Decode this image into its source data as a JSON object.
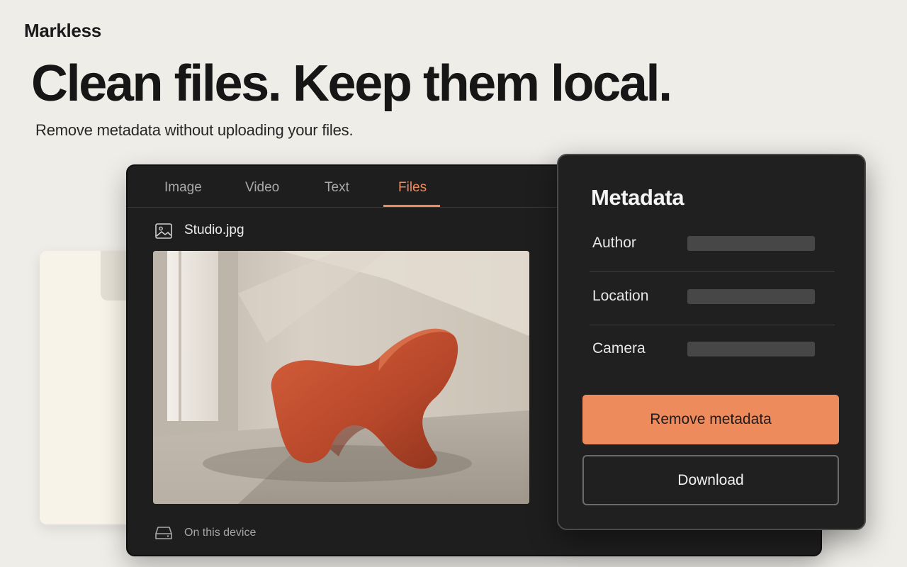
{
  "brand": "Markless",
  "hero": {
    "headline": "Clean files. Keep them local.",
    "subhead": "Remove metadata without uploading your files."
  },
  "tabs": [
    {
      "label": "Image",
      "active": false
    },
    {
      "label": "Video",
      "active": false
    },
    {
      "label": "Text",
      "active": false
    },
    {
      "label": "Files",
      "active": true
    }
  ],
  "file": {
    "icon": "image-icon",
    "name": "Studio.jpg",
    "preview_alt": "photo of orange lounge chair in sunlit room"
  },
  "storage": {
    "icon": "drive-icon",
    "label": "On this device"
  },
  "metadata": {
    "title": "Metadata",
    "fields": [
      {
        "label": "Author"
      },
      {
        "label": "Location"
      },
      {
        "label": "Camera"
      }
    ],
    "remove_label": "Remove metadata",
    "download_label": "Download"
  },
  "colors": {
    "accent": "#ee8b5d",
    "window": "#1e1e1e",
    "background": "#efede8"
  }
}
